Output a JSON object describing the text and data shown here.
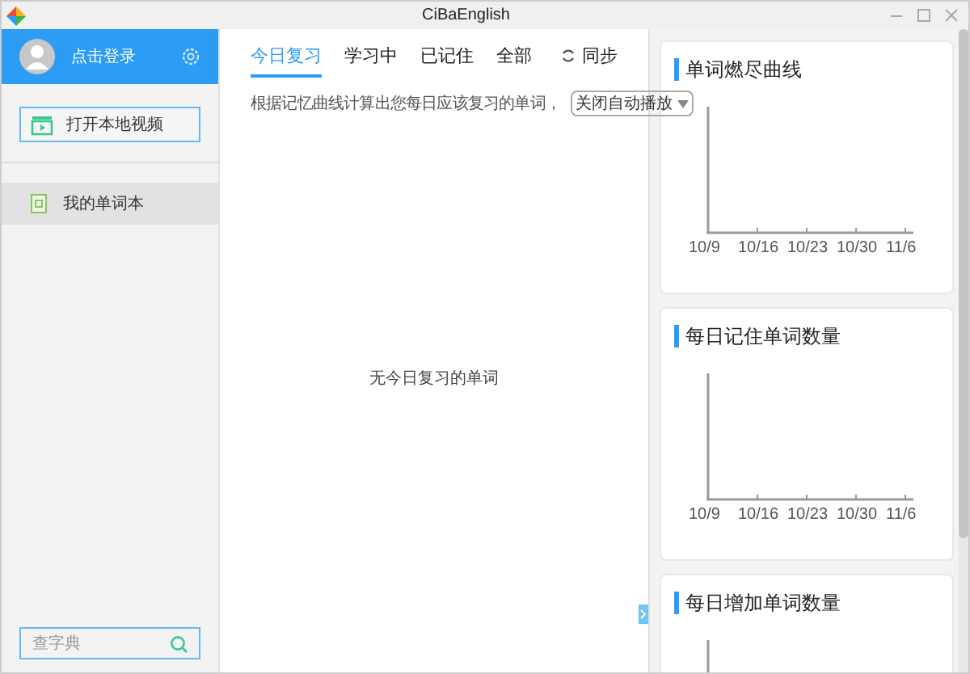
{
  "window": {
    "title": "CiBaEnglish"
  },
  "sidebar": {
    "login": "点击登录",
    "open_video": "打开本地视频",
    "items": [
      {
        "label": "我的单词本",
        "selected": true
      }
    ],
    "search": {
      "placeholder": "查字典"
    }
  },
  "tabs": [
    {
      "label": "今日复习",
      "selected": true
    },
    {
      "label": "学习中",
      "selected": false
    },
    {
      "label": "已记住",
      "selected": false
    },
    {
      "label": "全部",
      "selected": false
    }
  ],
  "sync": "同步",
  "hint": "根据记忆曲线计算出您每日应该复习的单词，",
  "autoplay": "关闭自动播放",
  "empty": "无今日复习的单词",
  "charts": [
    {
      "title": "单词燃尽曲线",
      "x_labels": [
        "10/9",
        "10/16",
        "10/23",
        "10/30",
        "11/6"
      ]
    },
    {
      "title": "每日记住单词数量",
      "x_labels": [
        "10/9",
        "10/16",
        "10/23",
        "10/30",
        "11/6"
      ]
    },
    {
      "title": "每日增加单词数量"
    }
  ]
}
